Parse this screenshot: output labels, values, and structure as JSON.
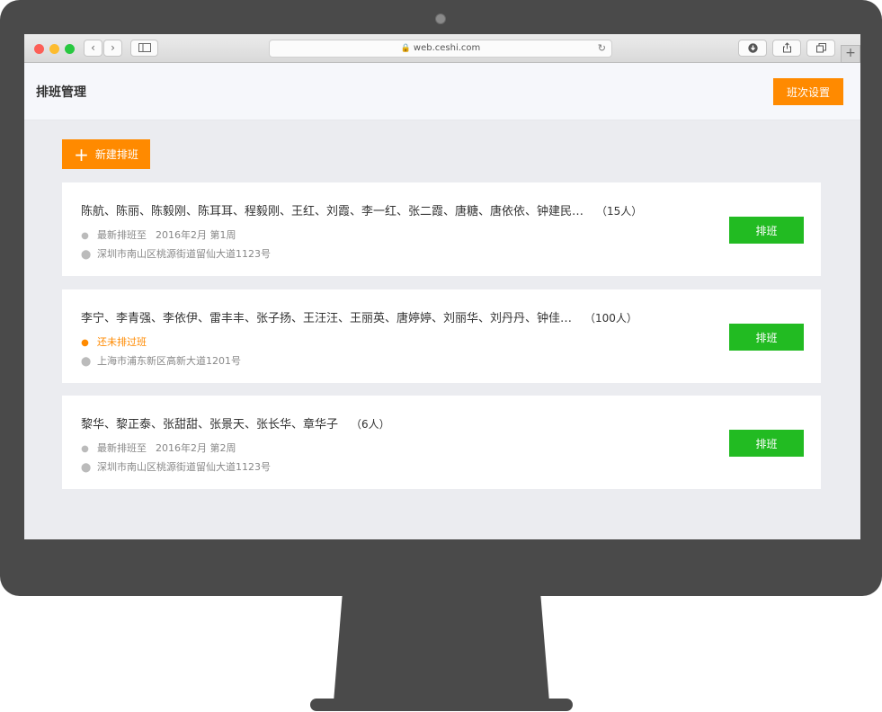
{
  "browser": {
    "url": "web.ceshi.com",
    "icons": {
      "back": "chevron-left-icon",
      "forward": "chevron-right-icon",
      "sidebar": "sidebar-icon",
      "lock": "lock-icon",
      "reload": "reload-icon",
      "download": "download-icon",
      "share": "share-icon",
      "tabs": "tabs-icon",
      "new_tab": "plus-icon"
    }
  },
  "header": {
    "title": "排班管理",
    "shift_settings_label": "班次设置"
  },
  "toolbar": {
    "new_schedule_label": "新建排班"
  },
  "cards": [
    {
      "names": "陈航、陈丽、陈毅刚、陈耳耳、程毅刚、王红、刘霞、李一红、张二霞、唐糖、唐依依、钟建民…",
      "count": "（15人）",
      "status_label": "最新排班至",
      "status_value": "2016年2月 第1周",
      "address": "深圳市南山区桃源街道留仙大道1123号",
      "action_label": "排班"
    },
    {
      "names": "李宁、李青强、李依伊、雷丰丰、张子扬、王汪汪、王丽英、唐婷婷、刘丽华、刘丹丹、钟佳…",
      "count": "（100人）",
      "status_label": "还未排过班",
      "address": "上海市浦东新区高新大道1201号",
      "action_label": "排班"
    },
    {
      "names": "黎华、黎正泰、张甜甜、张景天、张长华、章华子",
      "count": "（6人）",
      "status_label": "最新排班至",
      "status_value": "2016年2月 第2周",
      "address": "深圳市南山区桃源街道留仙大道1123号",
      "action_label": "排班"
    }
  ],
  "colors": {
    "accent_orange": "#ff8a00",
    "action_green": "#22bb22",
    "monitor_bezel": "#4a4a4a",
    "page_background": "#ebecf0"
  }
}
